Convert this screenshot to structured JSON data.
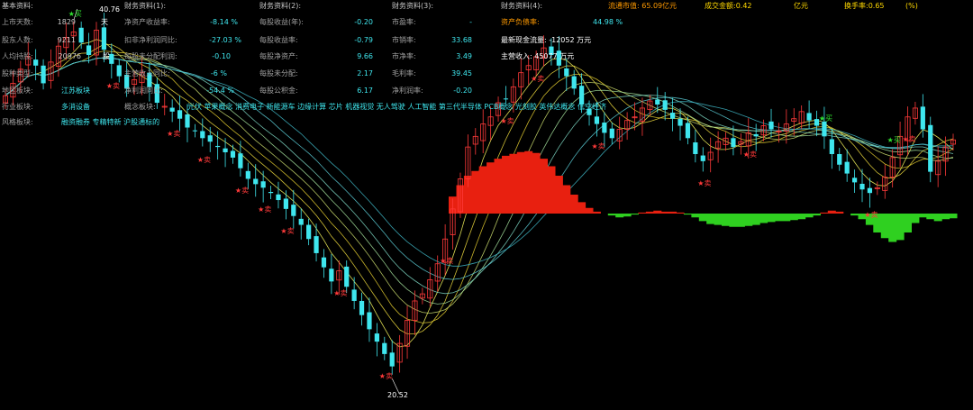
{
  "colors": {
    "background": "#000000",
    "label": "#a0a0a0",
    "concept": "#3fe6ee",
    "bullish_candle": "#ff3a3a",
    "bearish_candle": "#3fe6ee",
    "histogram_positive": "#e82010",
    "histogram_negative": "#2fd020",
    "buy_signal": "#2fe02f",
    "sell_signal": "#ff2a2a"
  },
  "basic": {
    "header": "基本资料:",
    "rows": [
      {
        "label": "上市天数:",
        "value": "1829"
      },
      {
        "label": "股东人数:",
        "value": "9211"
      },
      {
        "label": "人均持股:",
        "value": "20976"
      },
      {
        "label": "股种类型:",
        "value": ""
      },
      {
        "label": "地区板块:",
        "value": "江苏板块"
      },
      {
        "label": "行业板块:",
        "value": "多消设备"
      },
      {
        "label": "风格板块:",
        "value": "融资融券 专精特新 沪股通标的"
      }
    ],
    "side_marks": [
      "天",
      "",
      "股"
    ]
  },
  "finance1": {
    "header": "财务资料(1):",
    "rows": [
      {
        "label": "净资产收益率:",
        "value": "-8.14 %"
      },
      {
        "label": "扣非净利润同比:",
        "value": "-27.03 %"
      },
      {
        "label": "每股未分配利润:",
        "value": "-0.10"
      },
      {
        "label": "主营收入同比:",
        "value": "-6 %"
      },
      {
        "label": "净利润同比:",
        "value": "-54.4 %"
      },
      {
        "label": "概念板块:",
        "value": ""
      }
    ]
  },
  "finance2": {
    "header": "财务资料(2):",
    "rows": [
      {
        "label": "每股收益(年):",
        "value": "-0.20"
      },
      {
        "label": "每股收益率:",
        "value": "-0.79"
      },
      {
        "label": "每股净资产:",
        "value": "9.66"
      },
      {
        "label": "每股未分配:",
        "value": "2.17"
      },
      {
        "label": "每股公积金:",
        "value": "6.17"
      }
    ]
  },
  "finance3": {
    "header": "财务资料(3):",
    "rows": [
      {
        "label": "市盈率:",
        "value": "-"
      },
      {
        "label": "市销率:",
        "value": "33.68"
      },
      {
        "label": "市净率:",
        "value": "3.49"
      },
      {
        "label": "毛利率:",
        "value": "39.45"
      },
      {
        "label": "净利润率:",
        "value": "-0.20"
      }
    ]
  },
  "finance4": {
    "header": "财务资料(4):",
    "rows": [
      {
        "label": "资产负债率:",
        "value": "44.98 %"
      }
    ],
    "capital_flow": "最新现金流量: -12052 万元",
    "revenue": "主营收入: 45077 万元"
  },
  "topbar": {
    "market_cap": "流通市值: 65.09亿元",
    "turnover_amount": "成交金额:0.42",
    "unit_yi": "亿元",
    "turnover_rate": "换手率:0.65",
    "pct": "(%)"
  },
  "concepts": "光伏 苹果概念 消费电子 新能源车 边缘计算 芯片 机器视觉 无人驾驶 人工智能 第三代半导体 PCB概念 光刻胶 英伟达概念 低空经济",
  "signals": {
    "buy_label": "★买",
    "sell_label": "★卖"
  },
  "chart_data": {
    "type": "candlestick",
    "annotations": {
      "high": "40.76",
      "low": "20.52"
    },
    "high_value": 40.76,
    "low_value": 20.52,
    "price_range_estimate": [
      19.5,
      41.5
    ],
    "closes": [
      36.5,
      37.2,
      38.0,
      38.7,
      38.2,
      37.2,
      38.4,
      39.3,
      39.8,
      40.1,
      39.5,
      38.8,
      40.2,
      39.1,
      38.3,
      37.6,
      36.9,
      37.4,
      37.8,
      37.0,
      36.1,
      35.9,
      35.6,
      35.2,
      34.7,
      34.5,
      34.1,
      33.9,
      33.6,
      33.3,
      33.0,
      32.4,
      31.8,
      31.5,
      31.3,
      31.0,
      30.6,
      30.1,
      29.7,
      29.2,
      28.4,
      27.6,
      26.8,
      26.0,
      26.6,
      25.7,
      24.9,
      24.1,
      23.3,
      22.6,
      21.9,
      21.2,
      22.5,
      23.8,
      24.9,
      25.3,
      26.1,
      27.0,
      28.4,
      30.1,
      31.8,
      33.6,
      34.2,
      34.9,
      35.3,
      36.1,
      36.3,
      37.0,
      37.8,
      38.2,
      38.7,
      39.2,
      38.8,
      38.2,
      37.6,
      36.9,
      36.0,
      35.4,
      34.9,
      34.4,
      34.1,
      34.6,
      35.1,
      35.3,
      35.8,
      36.2,
      36.0,
      35.7,
      35.2,
      34.8,
      34.1,
      33.2,
      32.8,
      33.3,
      33.9,
      34.1,
      33.6,
      33.9,
      34.4,
      34.2,
      34.8,
      34.6,
      34.5,
      34.9,
      35.2,
      35.6,
      35.1,
      34.8,
      34.2,
      33.2,
      32.6,
      32.1,
      31.6,
      31.2,
      31.0,
      31.3,
      31.9,
      33.0,
      34.2,
      35.3,
      35.8,
      34.6,
      32.2,
      32.8,
      33.6,
      34.0
    ],
    "histogram": [
      0,
      0,
      0,
      0,
      0,
      0,
      0,
      0,
      0,
      0,
      0,
      0,
      0,
      0,
      0,
      0,
      0,
      0,
      0,
      0,
      0,
      0,
      0,
      0,
      0,
      0,
      0,
      0,
      0,
      0,
      0,
      0,
      0,
      0,
      0,
      0,
      0,
      0,
      0,
      0,
      0,
      0,
      0,
      0,
      0,
      0,
      0,
      0,
      0,
      0,
      0,
      0,
      0,
      0,
      0,
      0,
      0,
      0,
      0,
      18,
      30,
      40,
      45,
      50,
      54,
      58,
      61,
      63,
      65,
      66,
      64,
      58,
      50,
      40,
      30,
      20,
      12,
      6,
      2,
      0,
      -2,
      -4,
      -3,
      -1,
      1,
      2,
      3,
      2,
      2,
      1,
      -1,
      -4,
      -8,
      -11,
      -12,
      -13,
      -14,
      -14,
      -13,
      -12,
      -10,
      -9,
      -8,
      -8,
      -7,
      -6,
      -4,
      -2,
      1,
      3,
      2,
      0,
      -2,
      -6,
      -12,
      -20,
      -26,
      -30,
      -28,
      -20,
      -10,
      -4,
      -6,
      -8,
      -6,
      -5
    ]
  }
}
